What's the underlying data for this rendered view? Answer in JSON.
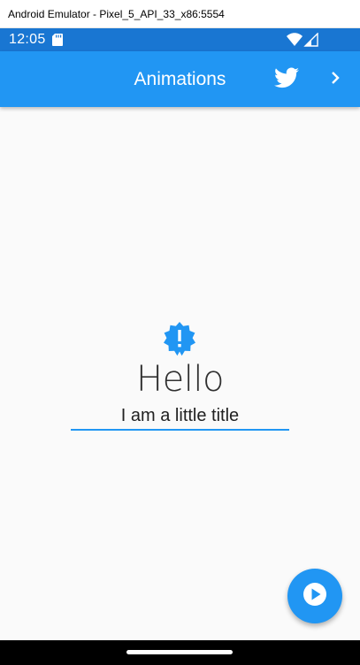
{
  "window": {
    "title": "Android Emulator - Pixel_5_API_33_x86:5554"
  },
  "status_bar": {
    "time": "12:05",
    "icons": [
      "sd-card-icon",
      "wifi-icon",
      "cellular-signal-icon"
    ]
  },
  "app_bar": {
    "title": "Animations",
    "actions": [
      "twitter-icon",
      "chevron-right-icon"
    ]
  },
  "content": {
    "badge_icon": "new-releases-icon",
    "headline": "Hello",
    "subtitle": "I am a little title"
  },
  "fab": {
    "icon": "play-arrow-icon"
  },
  "colors": {
    "primary": "#2196f3",
    "status_bar": "#1976d2",
    "background": "#fafafa",
    "on_primary": "#ffffff"
  }
}
